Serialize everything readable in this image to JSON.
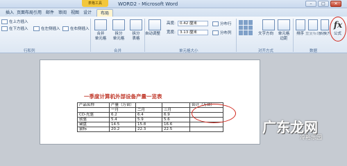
{
  "window": {
    "title": "WORD2 - Microsoft Word",
    "contextual_tab": "表格工具"
  },
  "window_controls": {
    "minimize": "–",
    "maximize": "□",
    "close": "✕"
  },
  "tabs": [
    {
      "label": "插入"
    },
    {
      "label": "页面布局"
    },
    {
      "label": "引用"
    },
    {
      "label": "邮件"
    },
    {
      "label": "审阅"
    },
    {
      "label": "视图"
    },
    {
      "label": "设计"
    },
    {
      "label": "布局"
    }
  ],
  "ribbon": {
    "rows_cols": {
      "insert_above": "在上方插入",
      "insert_below": "在下方插入",
      "insert_left": "在左侧插入",
      "insert_right": "在右侧插入",
      "group": "行和列"
    },
    "merge": {
      "merge_cells": "合并\n单元格",
      "split_cells": "拆分\n单元格",
      "split_table": "拆分\n表格",
      "group": "合并"
    },
    "cell_size": {
      "autofit": "自动调整",
      "height_label": "高度:",
      "height_value": "0.42 厘米",
      "width_label": "宽度:",
      "width_value": "3.13 厘米",
      "distribute_rows": "分布行",
      "distribute_cols": "分布列",
      "group": "单元格大小"
    },
    "alignment": {
      "text_direction": "文字方向",
      "cell_margins": "单元格\n边距",
      "group": "对齐方式"
    },
    "data": {
      "sort": "排序",
      "repeat_header": "重复标题行",
      "convert_to_text": "转换为文本",
      "formula": "公式",
      "group": "数据"
    }
  },
  "document": {
    "title": "一季度计算机外部设备产量一览表",
    "table": [
      [
        "产品名称",
        "产量（万台）",
        "",
        "",
        "合计（万台）"
      ],
      [
        "",
        "一月",
        "二月",
        "三月",
        ""
      ],
      [
        "CD-光驱",
        "6.2",
        "6.4",
        "6.9",
        ""
      ],
      [
        "软驱",
        "5.4",
        "5.9",
        "5.6",
        ""
      ],
      [
        "键盘",
        "14.5",
        "15.8",
        "16.6",
        ""
      ],
      [
        "鼠标",
        "20.2",
        "22.3",
        "22.5",
        ""
      ]
    ]
  },
  "watermark": {
    "main": "广东龙网",
    "sub": "冷裕乐园"
  }
}
